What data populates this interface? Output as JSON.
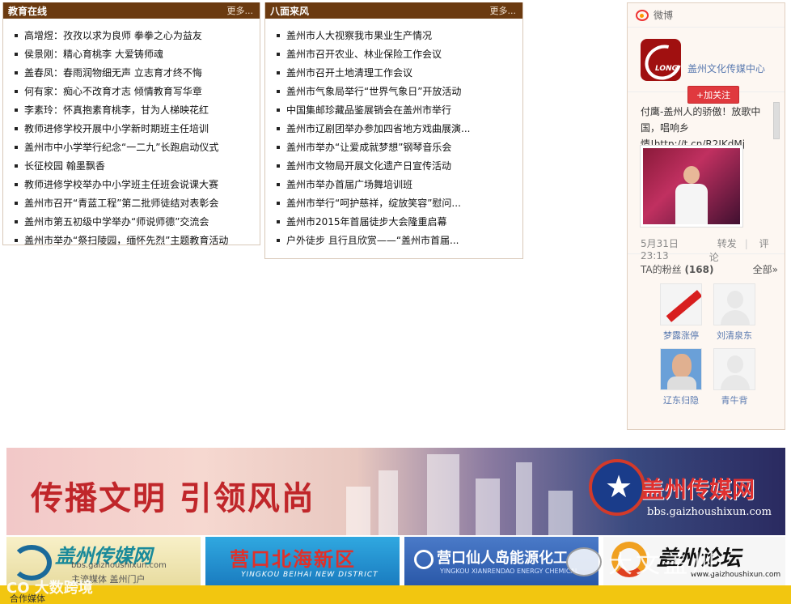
{
  "edu_panel": {
    "title": "教育在线",
    "more": "更多...",
    "items": [
      "高增煜：孜孜以求为良师 拳拳之心为益友",
      "侯景刚：精心育桃李 大爱铸师魂",
      "盖春凤：春雨润物细无声 立志育才终不悔",
      "何有家：痴心不改育才志 倾情教育写华章",
      "李素玲：怀真抱素育桃李，甘为人梯映花红",
      "教师进修学校开展中小学新时期班主任培训",
      "盖州市中小学举行纪念“一二九”长跑启动仪式",
      "长征校园 翰墨飘香",
      "教师进修学校举办中小学班主任班会说课大赛",
      "盖州市召开“青蓝工程”第二批师徒结对表彰会",
      "盖州市第五初级中学举办“师说师德”交流会",
      "盖州市举办“祭扫陵园，缅怀先烈”主题教育活动"
    ]
  },
  "news_panel": {
    "title": "八面来风",
    "more": "更多...",
    "items": [
      "盖州市人大视察我市果业生产情况",
      "盖州市召开农业、林业保险工作会议",
      "盖州市召开土地清理工作会议",
      "盖州市气象局举行“世界气象日”开放活动",
      "中国集邮珍藏品鉴展销会在盖州市举行",
      "盖州市辽剧团举办参加四省地方戏曲展演...",
      "盖州市举办“让爱成就梦想”钢琴音乐会",
      "盖州市文物局开展文化遗产日宣传活动",
      "盖州市举办首届广场舞培训班",
      "盖州市举行“呵护慈祥，绽放笑容”慰问...",
      "盖州市2015年首届徒步大会隆重启幕",
      "户外徒步 且行且欣赏——“盖州市首届..."
    ]
  },
  "weibo": {
    "header": "微博",
    "account_name": "盖州文化传媒中心",
    "avatar_text": "LONG",
    "follow_label": "+加关注",
    "post_text": "付鹰-盖州人的骄傲！放歌中国，唱响乡情!",
    "post_link": "http://t.cn/R2JKdMj",
    "post_time": "5月31日 23:13",
    "repost_label": "转发",
    "comment_label": "评论",
    "fans_label": "TA的粉丝",
    "fans_count": "(168)",
    "all_label": "全部»",
    "fans": [
      "梦露涨停",
      "刘清泉东",
      "辽东归隐",
      "青牛背"
    ]
  },
  "banner": {
    "slogan": "传播文明 引领风尚",
    "brand": "盖州传媒网",
    "url": "bbs.gaizhoushixun.com"
  },
  "partner_links": [
    {
      "title": "盖州传媒网",
      "sub1": "bbs.gaizhoushixun.com",
      "sub2": "主流媒体 盖州门户"
    },
    {
      "title": "营口北海新区",
      "sub1": "YINGKOU BEIHAI NEW DISTRICT"
    },
    {
      "title": "营口仙人岛能源化工",
      "sub1": "YINGKOU XIANRENDAO ENERGY CHEMICAL"
    },
    {
      "title": "盖州论坛",
      "sub1": "www.gaizhoushixun.com"
    }
  ],
  "footer": {
    "label": "合作媒体"
  },
  "watermarks": {
    "right": "大文盖州",
    "bottom": "CO 大数跨境"
  }
}
